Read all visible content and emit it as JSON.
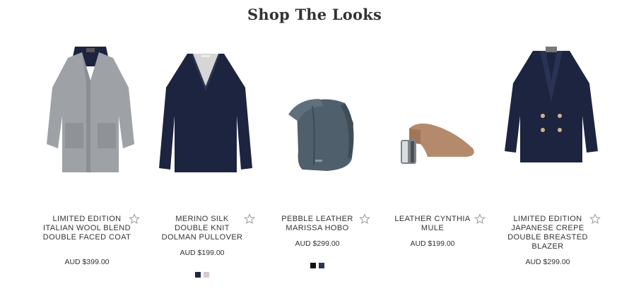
{
  "section": {
    "title": "Shop The Looks"
  },
  "products": [
    {
      "name": "LIMITED EDITION ITALIAN WOOL BLEND DOUBLE FACED COAT",
      "price": "AUD $399.00",
      "image": "grey-coat",
      "swatches": []
    },
    {
      "name": "MERINO SILK DOUBLE KNIT DOLMAN PULLOVER",
      "price": "AUD $199.00",
      "image": "navy-pullover",
      "swatches": [
        "#1f2744",
        "#d8c7d0"
      ]
    },
    {
      "name": "PEBBLE LEATHER MARISSA HOBO",
      "price": "AUD $299.00",
      "image": "slate-hobo-bag",
      "swatches": [
        "#111111",
        "#2c3552"
      ]
    },
    {
      "name": "LEATHER CYNTHIA MULE",
      "price": "AUD $199.00",
      "image": "tan-mule",
      "swatches": []
    },
    {
      "name": "LIMITED EDITION JAPANESE CREPE DOUBLE BREASTED BLAZER",
      "price": "AUD $299.00",
      "image": "navy-blazer",
      "swatches": []
    }
  ],
  "colors": {
    "text": "#333333",
    "star": "#9a9a9a"
  }
}
